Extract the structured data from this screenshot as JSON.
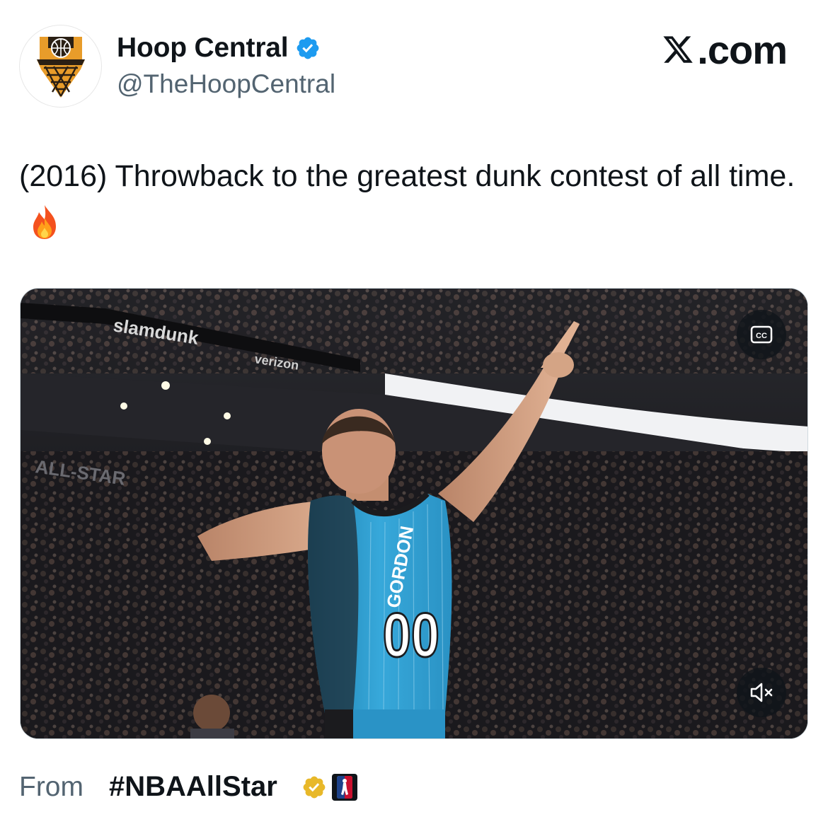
{
  "author": {
    "display_name": "Hoop Central",
    "handle": "@TheHoopCentral",
    "verified": true
  },
  "brand": {
    "site_label": ".com",
    "logo_icon": "x-logo-icon"
  },
  "tweet": {
    "text": "(2016) Throwback to the greatest dunk contest of all time.",
    "emoji": "fire-emoji"
  },
  "media": {
    "type": "video",
    "jersey_number": "00",
    "jersey_name": "GORDON",
    "sponsor_text_1": "verizon",
    "sponsor_text_2": "slamdunk",
    "arena_text": "ALL-STAR",
    "controls": {
      "captions_label": "CC",
      "mute_icon": "muted-speaker-icon"
    },
    "colors": {
      "jersey_blue": "#2f9ecf",
      "jersey_black": "#1b1b1e"
    }
  },
  "footer": {
    "from_label": "From",
    "hashtag": "#NBAAllStar",
    "gold_badge_icon": "gold-verified-icon",
    "org_icon": "nba-logo-icon"
  },
  "colors": {
    "verified_blue": "#1d9bf0",
    "gold": "#e8b829",
    "secondary_text": "#536471"
  }
}
